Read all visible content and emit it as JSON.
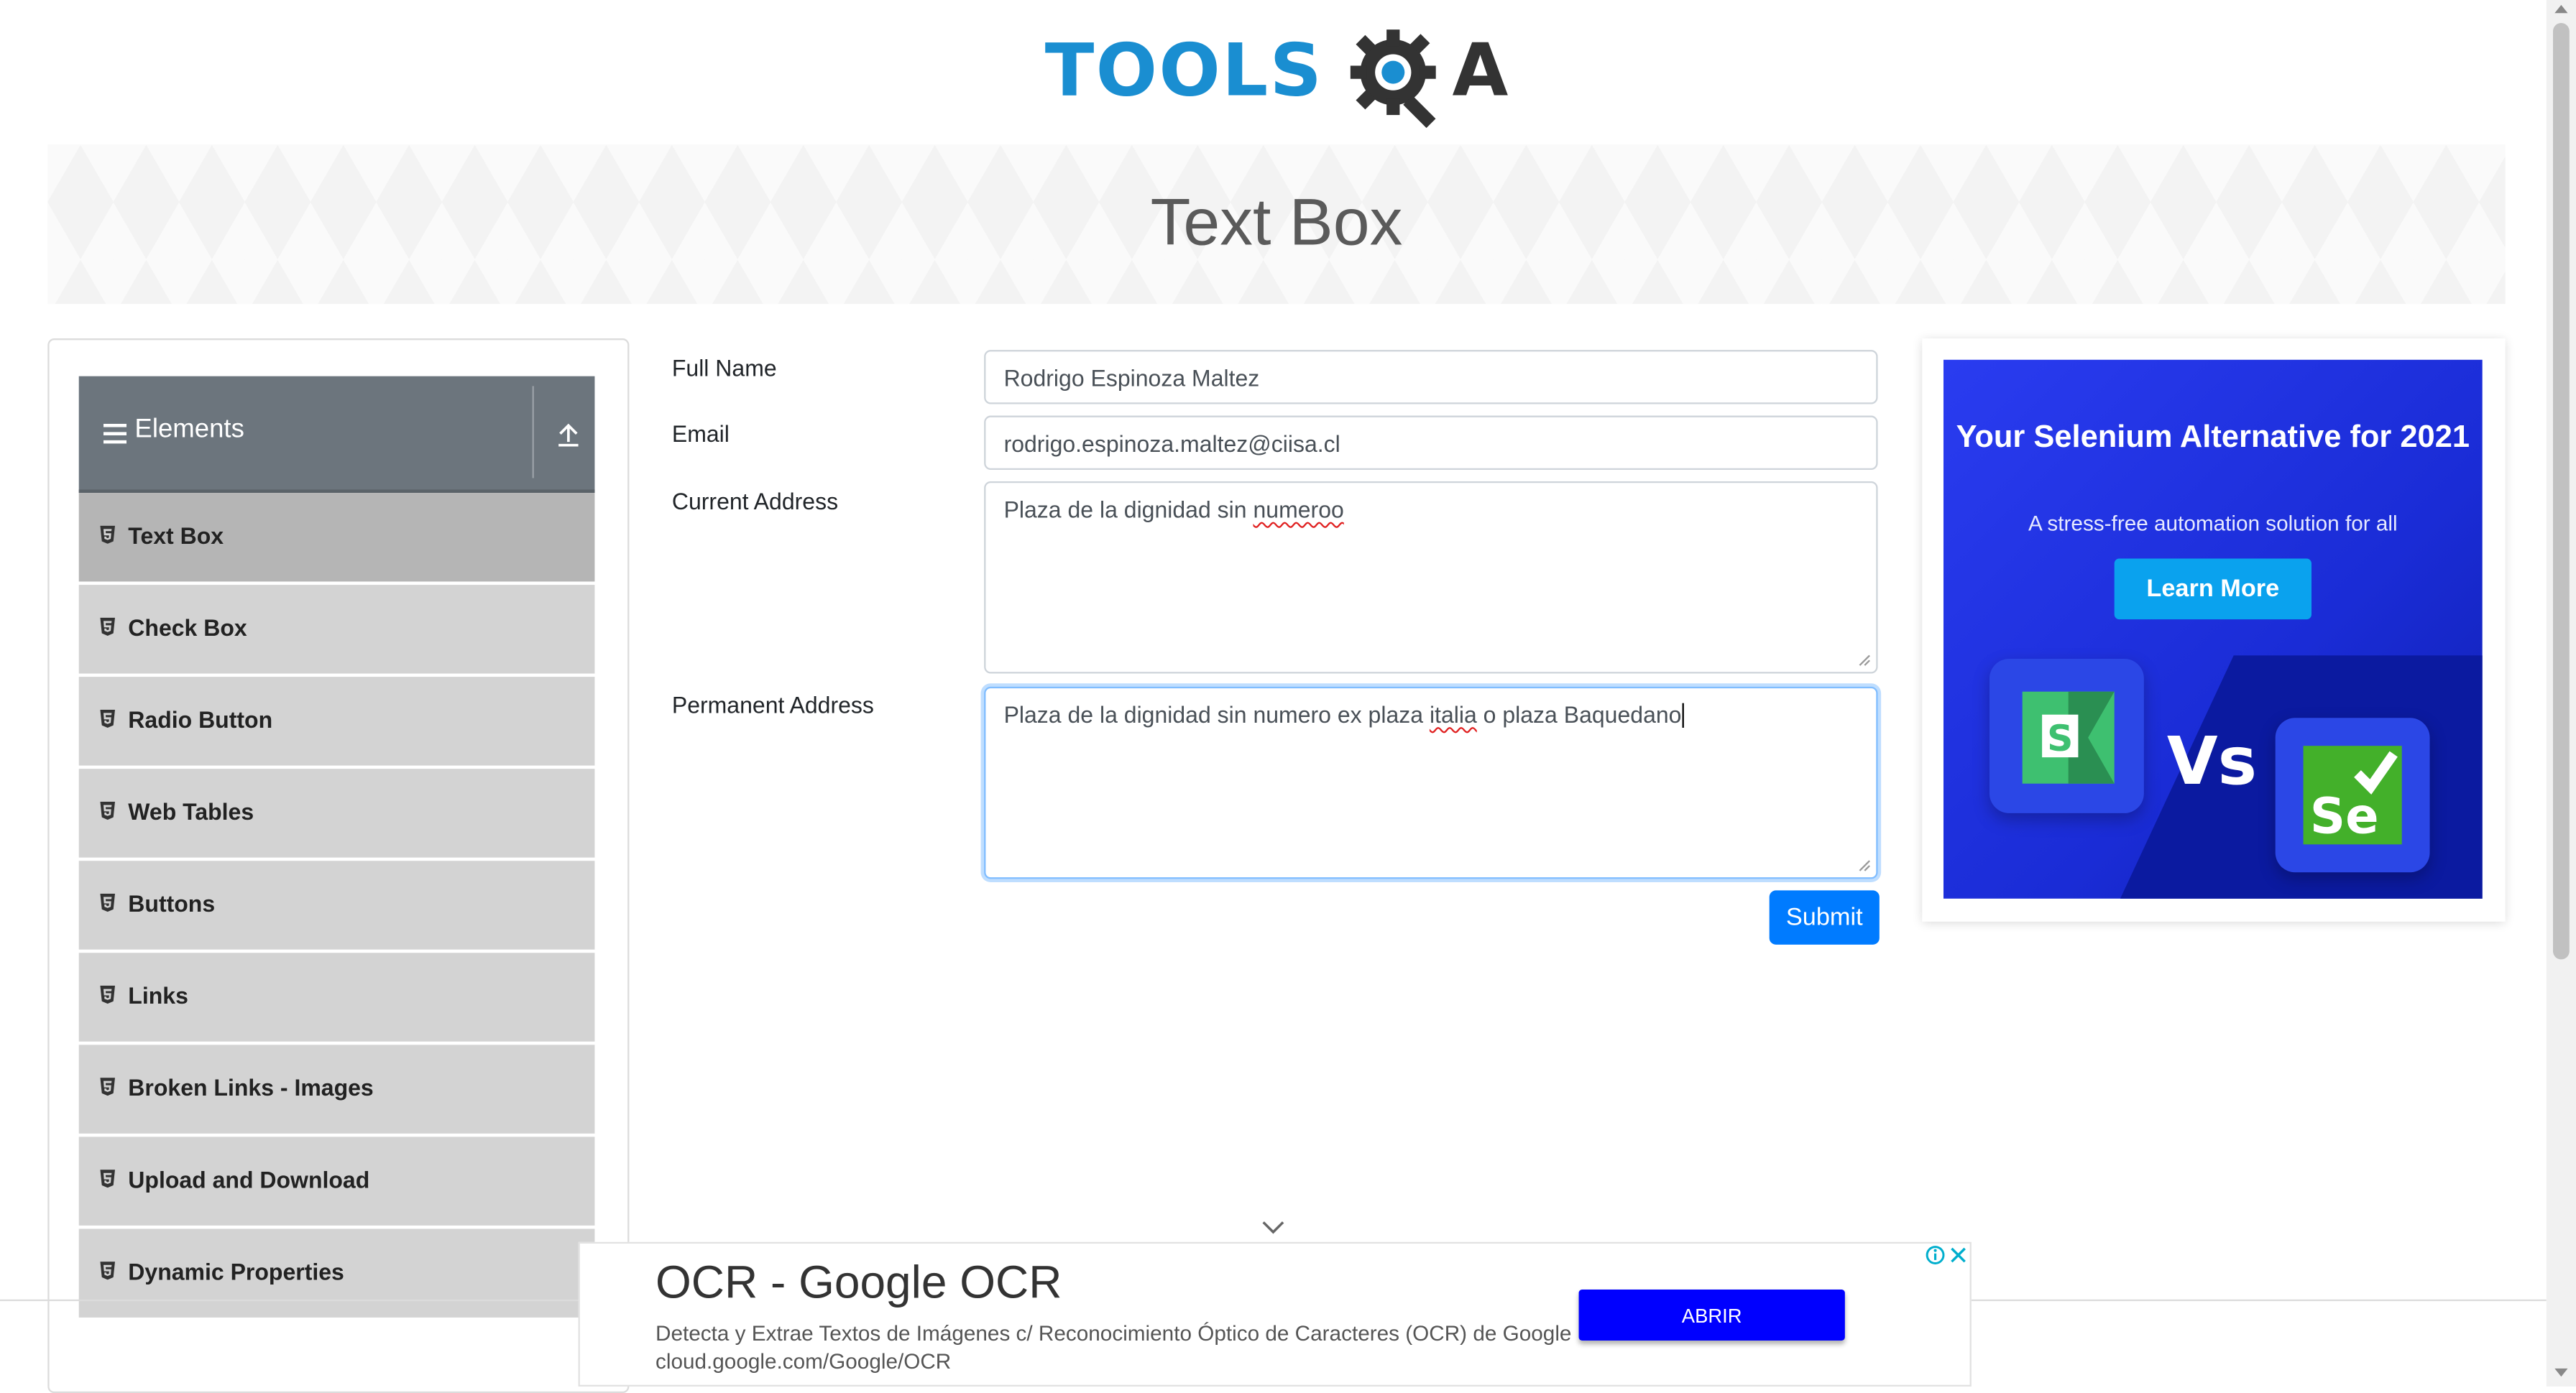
{
  "header": {
    "logo_text": "TOOLS",
    "logo_tail": "A",
    "page_title": "Text Box"
  },
  "sidebar": {
    "group_title": "Elements",
    "items": [
      {
        "label": "Text Box",
        "active": true
      },
      {
        "label": "Check Box"
      },
      {
        "label": "Radio Button"
      },
      {
        "label": "Web Tables"
      },
      {
        "label": "Buttons"
      },
      {
        "label": "Links"
      },
      {
        "label": "Broken Links - Images"
      },
      {
        "label": "Upload and Download"
      },
      {
        "label": "Dynamic Properties"
      }
    ]
  },
  "form": {
    "full_name": {
      "label": "Full Name",
      "value": "Rodrigo Espinoza Maltez"
    },
    "email": {
      "label": "Email",
      "value": "rodrigo.espinoza.maltez@ciisa.cl"
    },
    "current_address": {
      "label": "Current Address",
      "value_before": "Plaza de la dignidad sin ",
      "value_misspelled": "numeroo"
    },
    "permanent_address": {
      "label": "Permanent Address",
      "value_before": "Plaza de la dignidad sin numero ex plaza ",
      "value_misspelled": "italia",
      "value_after": " o plaza Baquedano"
    },
    "submit_label": "Submit"
  },
  "side_ad": {
    "title": "Your Selenium Alternative for 2021",
    "subtitle": "A stress-free automation solution for all",
    "button": "Learn More",
    "left_logo": "S",
    "vs": "Vs",
    "right_logo": "Se"
  },
  "bottom_ad": {
    "title": "OCR - Google OCR",
    "text": "Detecta y Extrae Textos de Imágenes c/ Reconocimiento Óptico de Caracteres (OCR) de Google cloud.google.com/Google/OCR",
    "button": "ABRIR"
  },
  "colors": {
    "primary": "#007bff",
    "sidebar_header": "#6c757d",
    "sidebar_item": "#d3d3d3",
    "logo_blue": "#1a8ed1",
    "ad_blue": "#2a3cf0"
  }
}
